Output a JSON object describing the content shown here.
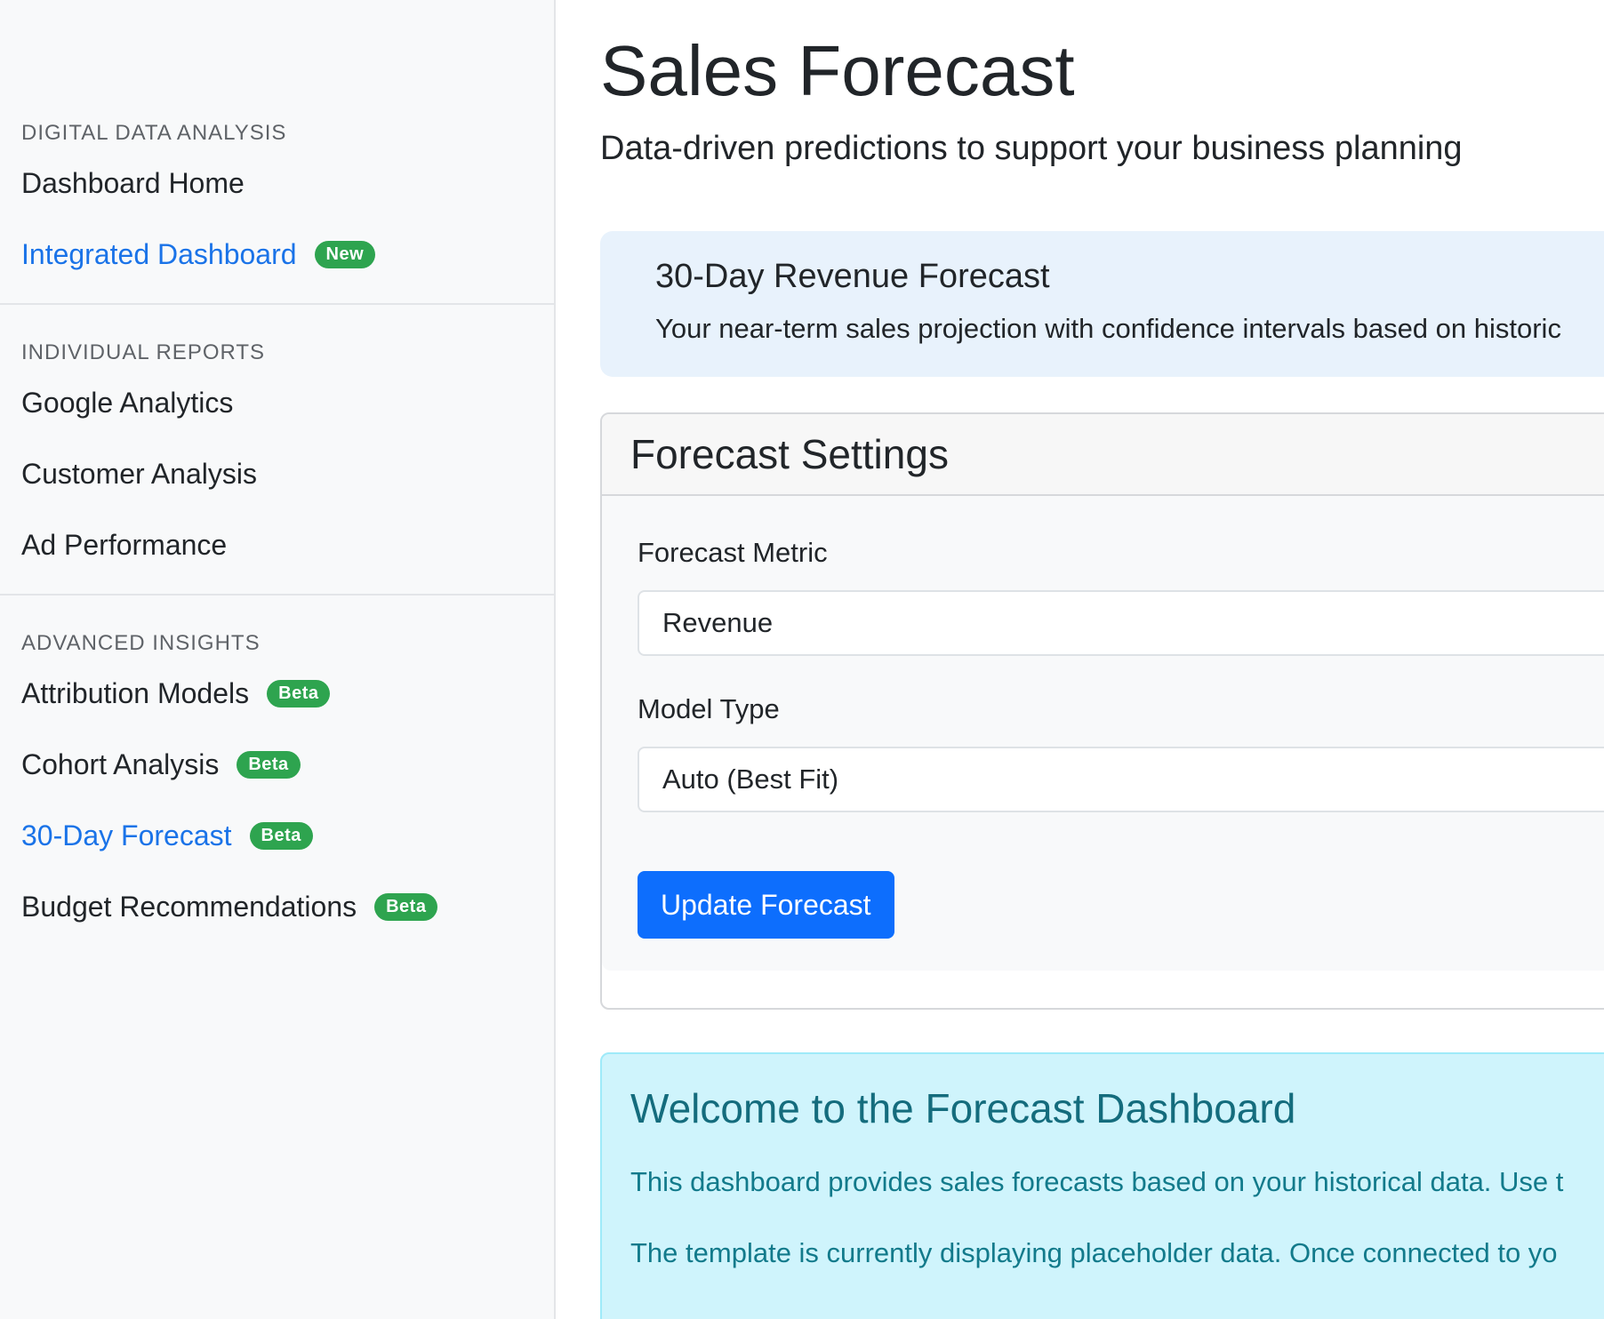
{
  "sidebar": {
    "sections": [
      {
        "heading": "DIGITAL DATA ANALYSIS",
        "items": [
          {
            "label": "Dashboard Home",
            "badge": ""
          },
          {
            "label": "Integrated Dashboard",
            "badge": "New"
          }
        ]
      },
      {
        "heading": "INDIVIDUAL REPORTS",
        "items": [
          {
            "label": "Google Analytics",
            "badge": ""
          },
          {
            "label": "Customer Analysis",
            "badge": ""
          },
          {
            "label": "Ad Performance",
            "badge": ""
          }
        ]
      },
      {
        "heading": "ADVANCED INSIGHTS",
        "items": [
          {
            "label": "Attribution Models",
            "badge": "Beta"
          },
          {
            "label": "Cohort Analysis",
            "badge": "Beta"
          },
          {
            "label": "30-Day Forecast",
            "badge": "Beta"
          },
          {
            "label": "Budget Recommendations",
            "badge": "Beta"
          }
        ]
      }
    ]
  },
  "main": {
    "title": "Sales Forecast",
    "subtitle": "Data-driven predictions to support your business planning",
    "hero": {
      "title": "30-Day Revenue Forecast",
      "text": "Your near-term sales projection with confidence intervals based on historic"
    },
    "settings": {
      "title": "Forecast Settings",
      "metric_label": "Forecast Metric",
      "metric_value": "Revenue",
      "model_label": "Model Type",
      "model_value": "Auto (Best Fit)",
      "button_label": "Update Forecast"
    },
    "welcome": {
      "title": "Welcome to the Forecast Dashboard",
      "line1": "This dashboard provides sales forecasts based on your historical data. Use t",
      "line2": "The template is currently displaying placeholder data. Once connected to yo"
    }
  },
  "colors": {
    "active_link": "#1a73e8",
    "badge": "#2ea44f",
    "primary_button": "#0d6efd",
    "hero_bg": "#e8f2fc",
    "alert_bg": "#cff4fc",
    "alert_text": "#127a8b"
  }
}
